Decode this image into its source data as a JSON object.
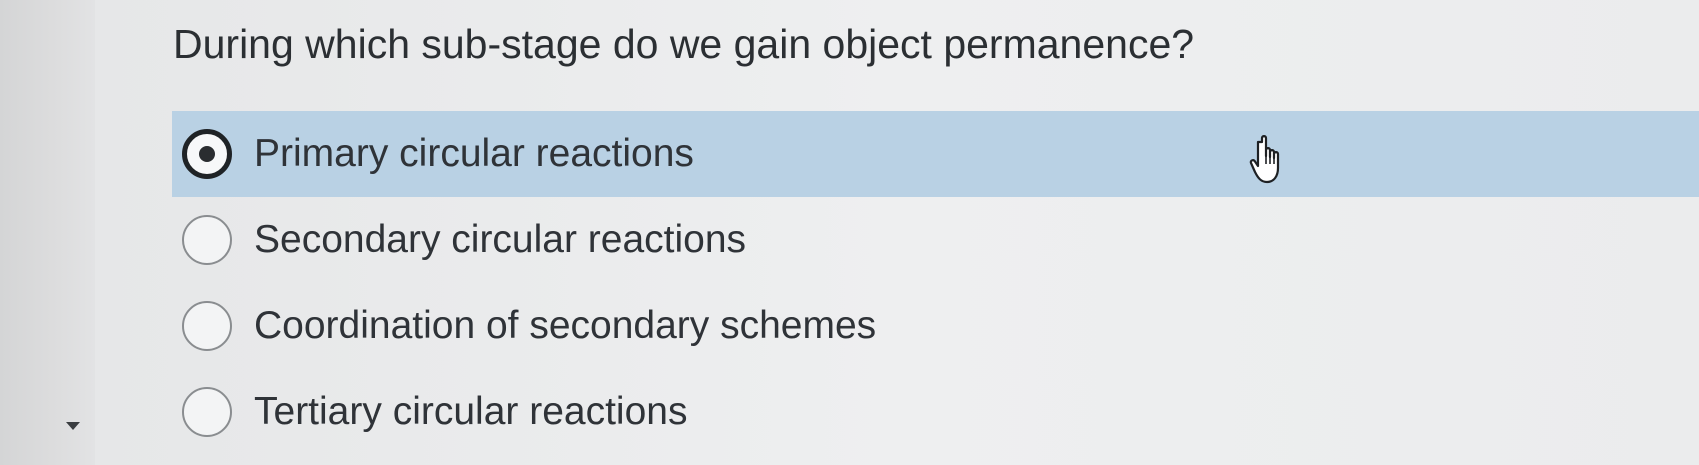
{
  "question": {
    "text": "During which sub-stage do we gain object permanence?"
  },
  "options": [
    {
      "label": "Primary circular reactions",
      "selected": true
    },
    {
      "label": "Secondary circular reactions",
      "selected": false
    },
    {
      "label": "Coordination of secondary schemes",
      "selected": false
    },
    {
      "label": "Tertiary circular reactions",
      "selected": false
    }
  ],
  "icons": {
    "cursor": "hand-pointer-icon",
    "scroll_arrow": "caret-down-icon"
  },
  "colors": {
    "selected_highlight": "#b9d1e4",
    "background": "#eeeff0"
  }
}
